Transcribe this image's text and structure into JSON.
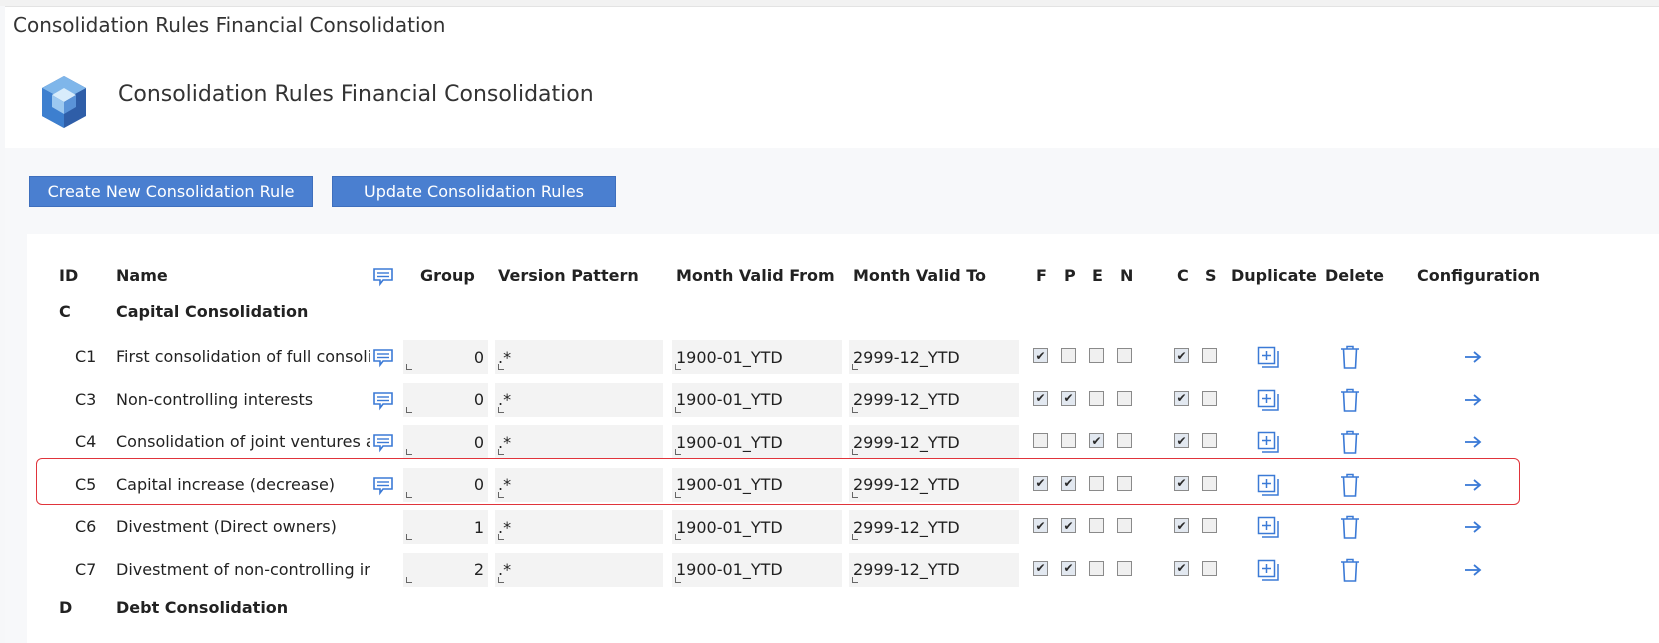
{
  "page": {
    "title": "Consolidation Rules Financial Consolidation"
  },
  "header": {
    "title": "Consolidation Rules Financial Consolidation"
  },
  "toolbar": {
    "create_label": "Create New Consolidation Rule",
    "update_label": "Update Consolidation Rules"
  },
  "table": {
    "columns": {
      "id": "ID",
      "name": "Name",
      "group": "Group",
      "version_pattern": "Version Pattern",
      "month_valid_from": "Month Valid From",
      "month_valid_to": "Month Valid To",
      "f": "F",
      "p": "P",
      "e": "E",
      "n": "N",
      "c": "C",
      "s": "S",
      "duplicate": "Duplicate",
      "delete": "Delete",
      "configuration": "Configuration"
    },
    "sections": [
      {
        "id": "C",
        "name": "Capital Consolidation"
      },
      {
        "id": "D",
        "name": "Debt Consolidation"
      }
    ],
    "rows": [
      {
        "id": "C1",
        "name": "First consolidation of full consolid",
        "has_comment": true,
        "group": "0",
        "version_pattern": ".*",
        "month_from": "1900-01_YTD",
        "month_to": "2999-12_YTD",
        "flags": {
          "F": true,
          "P": false,
          "E": false,
          "N": false,
          "C": true,
          "S": false
        }
      },
      {
        "id": "C3",
        "name": "Non-controlling interests",
        "has_comment": true,
        "group": "0",
        "version_pattern": ".*",
        "month_from": "1900-01_YTD",
        "month_to": "2999-12_YTD",
        "flags": {
          "F": true,
          "P": true,
          "E": false,
          "N": false,
          "C": true,
          "S": false
        }
      },
      {
        "id": "C4",
        "name": "Consolidation of joint ventures ar",
        "has_comment": true,
        "group": "0",
        "version_pattern": ".*",
        "month_from": "1900-01_YTD",
        "month_to": "2999-12_YTD",
        "flags": {
          "F": false,
          "P": false,
          "E": true,
          "N": false,
          "C": true,
          "S": false
        }
      },
      {
        "id": "C5",
        "name": "Capital increase (decrease)",
        "has_comment": true,
        "group": "0",
        "version_pattern": ".*",
        "month_from": "1900-01_YTD",
        "month_to": "2999-12_YTD",
        "flags": {
          "F": true,
          "P": true,
          "E": false,
          "N": false,
          "C": true,
          "S": false
        }
      },
      {
        "id": "C6",
        "name": "Divestment (Direct owners)",
        "has_comment": false,
        "group": "1",
        "version_pattern": ".*",
        "month_from": "1900-01_YTD",
        "month_to": "2999-12_YTD",
        "flags": {
          "F": true,
          "P": true,
          "E": false,
          "N": false,
          "C": true,
          "S": false
        }
      },
      {
        "id": "C7",
        "name": "Divestment of non-controlling int",
        "has_comment": false,
        "group": "2",
        "version_pattern": ".*",
        "month_from": "1900-01_YTD",
        "month_to": "2999-12_YTD",
        "flags": {
          "F": true,
          "P": true,
          "E": false,
          "N": false,
          "C": true,
          "S": false
        }
      }
    ]
  },
  "colors": {
    "button": "#4a7fd0",
    "icon_blue": "#3b7ad6",
    "highlight": "#e0343b"
  },
  "icons": {
    "logo": "cube-logo-icon",
    "comment": "comment-icon",
    "duplicate": "duplicate-icon",
    "delete": "trash-icon",
    "configuration": "arrow-right-icon"
  }
}
